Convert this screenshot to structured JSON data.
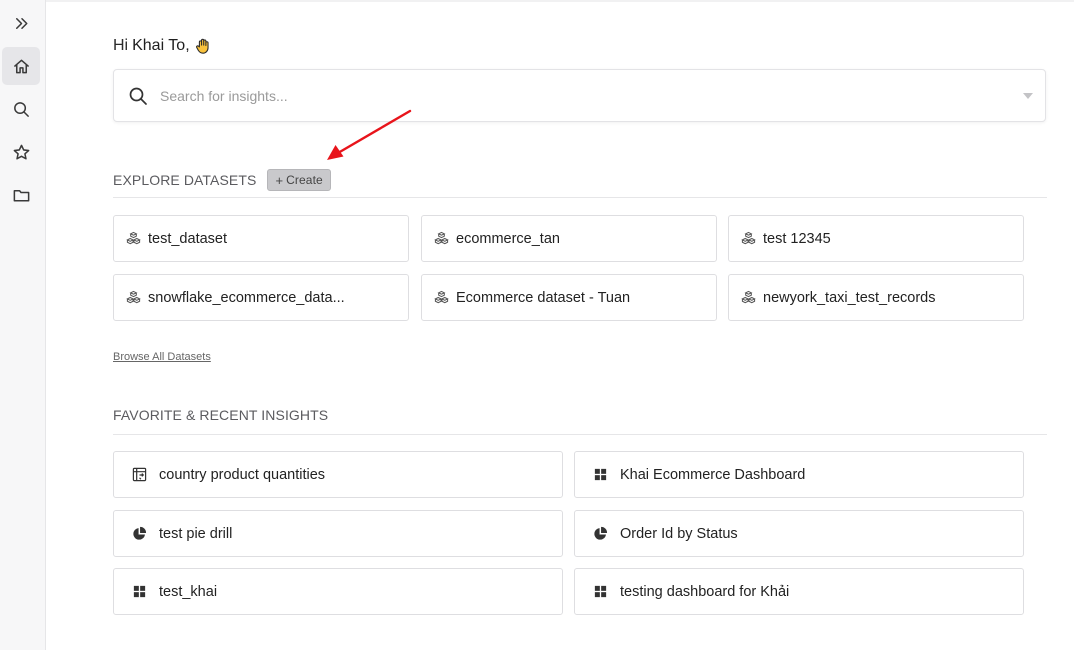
{
  "greeting": {
    "prefix": "Hi",
    "name": "Khai To,"
  },
  "search": {
    "placeholder": "Search for insights..."
  },
  "datasets": {
    "title": "EXPLORE DATASETS",
    "create_label": "Create",
    "items": [
      {
        "label": "test_dataset"
      },
      {
        "label": "ecommerce_tan"
      },
      {
        "label": "test 12345"
      },
      {
        "label": "snowflake_ecommerce_data..."
      },
      {
        "label": "Ecommerce dataset - Tuan"
      },
      {
        "label": "newyork_taxi_test_records"
      }
    ],
    "browse_label": "Browse All Datasets"
  },
  "insights": {
    "title": "FAVORITE & RECENT INSIGHTS",
    "items": [
      {
        "label": "country product quantities",
        "icon": "pivot-table-icon"
      },
      {
        "label": "Khai Ecommerce Dashboard",
        "icon": "dashboard-icon"
      },
      {
        "label": "test pie drill",
        "icon": "pie-chart-icon"
      },
      {
        "label": "Order Id by Status",
        "icon": "pie-chart-icon"
      },
      {
        "label": "test_khai",
        "icon": "dashboard-icon"
      },
      {
        "label": "testing dashboard for Khải",
        "icon": "dashboard-icon"
      }
    ]
  },
  "colors": {
    "annotation_arrow": "#e8141b",
    "sidebar_bg": "#f7f7f8",
    "active_nav_bg": "#e6e6e9"
  }
}
